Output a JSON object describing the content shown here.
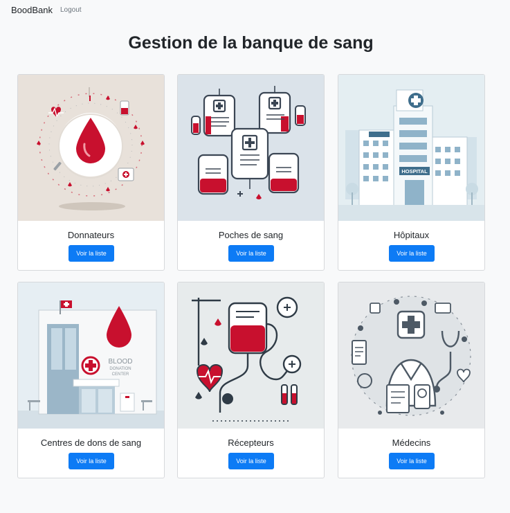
{
  "navbar": {
    "brand": "BoodBank",
    "logout": "Logout"
  },
  "page": {
    "title": "Gestion de la banque de sang"
  },
  "cards": [
    {
      "title": "Donnateurs",
      "button": "Voir la liste",
      "icon": "blood-drop-icon"
    },
    {
      "title": "Poches de sang",
      "button": "Voir la liste",
      "icon": "blood-bag-icon"
    },
    {
      "title": "Hôpitaux",
      "button": "Voir la liste",
      "icon": "hospital-icon"
    },
    {
      "title": "Centres de dons de sang",
      "button": "Voir la liste",
      "icon": "donation-center-icon"
    },
    {
      "title": "Récepteurs",
      "button": "Voir la liste",
      "icon": "blood-transfusion-icon"
    },
    {
      "title": "Médecins",
      "button": "Voir la liste",
      "icon": "doctor-icon"
    }
  ],
  "images": {
    "donation_center_sign": [
      "BLOOD",
      "DONATION",
      "CENTER"
    ],
    "hospital_sign": "HOSPITAL"
  },
  "colors": {
    "primary_button": "#0d7bf5",
    "blood_red": "#c8102e",
    "background": "#f8f9fa"
  }
}
